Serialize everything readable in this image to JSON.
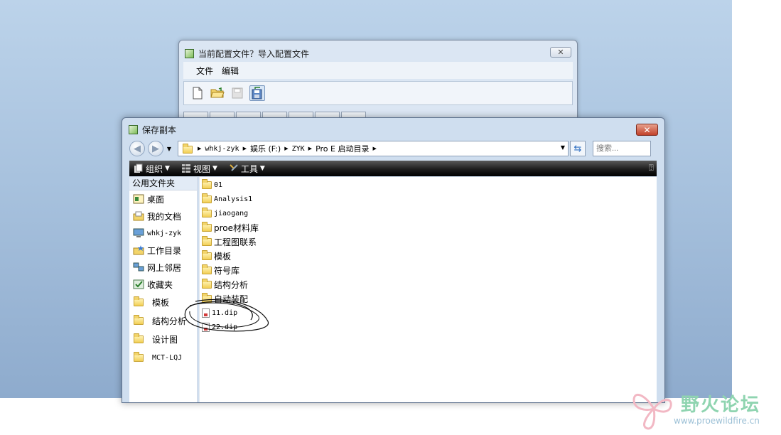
{
  "config_window": {
    "title": "当前配置文件？导入配置文件",
    "close_label": "✕",
    "menu": [
      "文件",
      "编辑"
    ]
  },
  "save_dialog": {
    "title": "保存副本",
    "close_label": "✕",
    "breadcrumb": [
      "whkj-zyk",
      "娱乐 (F:)",
      "ZYK",
      "Pro E 启动目录"
    ],
    "search_placeholder": "搜索...",
    "commands": {
      "organize": "组织",
      "views": "视图",
      "tools": "工具"
    },
    "sidebar": {
      "header": "公用文件夹",
      "items": [
        "桌面",
        "我的文档",
        "whkj-zyk",
        "工作目录",
        "网上邻居",
        "收藏夹"
      ],
      "favorites": [
        "模板",
        "结构分析",
        "设计图",
        "MCT-LQJ"
      ]
    },
    "files": {
      "folders": [
        "01",
        "Analysis1",
        "jiaogang",
        "proe材料库",
        "工程图联系",
        "模板",
        "符号库",
        "结构分析",
        "自动装配"
      ],
      "documents": [
        "11.dip",
        "22.dip"
      ]
    }
  },
  "watermark": {
    "name": "野火论坛",
    "url": "www.proewildfire.cn"
  }
}
